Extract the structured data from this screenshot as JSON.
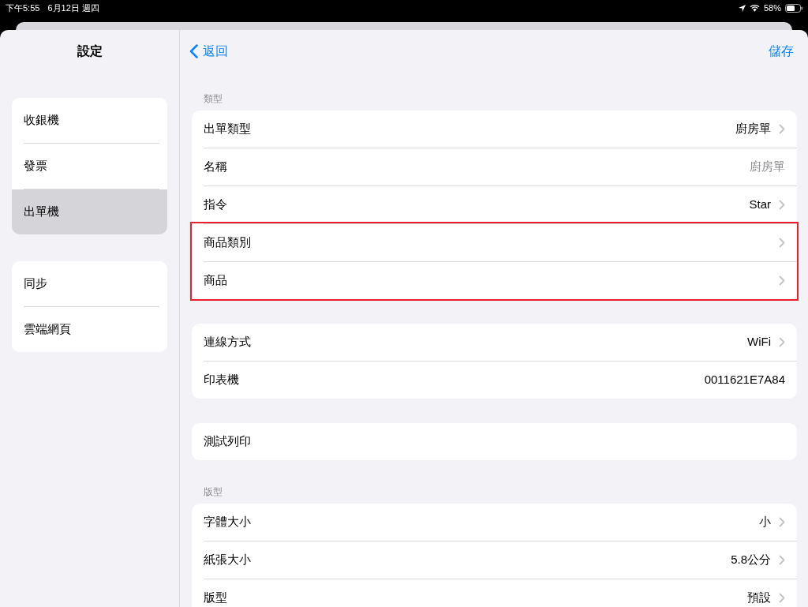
{
  "status_bar": {
    "time": "下午5:55",
    "date": "6月12日 週四",
    "battery": "58%"
  },
  "sidebar": {
    "title": "設定",
    "groups": [
      [
        {
          "label": "收銀機",
          "selected": false
        },
        {
          "label": "發票",
          "selected": false
        },
        {
          "label": "出單機",
          "selected": true
        }
      ],
      [
        {
          "label": "同步",
          "selected": false
        },
        {
          "label": "雲端網頁",
          "selected": false
        }
      ]
    ]
  },
  "nav": {
    "back": "返回",
    "save": "儲存"
  },
  "sections": [
    {
      "header": "類型",
      "rows": [
        {
          "kind": "nav",
          "label": "出單類型",
          "value": "廚房單",
          "highlighted": false
        },
        {
          "kind": "field",
          "label": "名稱",
          "placeholder": "廚房單",
          "highlighted": false
        },
        {
          "kind": "nav",
          "label": "指令",
          "value": "Star",
          "highlighted": false
        },
        {
          "kind": "nav",
          "label": "商品類別",
          "highlighted": true
        },
        {
          "kind": "nav",
          "label": "商品",
          "highlighted": true
        }
      ]
    },
    {
      "rows": [
        {
          "kind": "nav",
          "label": "連線方式",
          "value": "WiFi",
          "highlighted": false
        },
        {
          "kind": "info",
          "label": "印表機",
          "value": "0011621E7A84",
          "highlighted": false
        }
      ]
    },
    {
      "rows": [
        {
          "kind": "action",
          "label": "測試列印",
          "highlighted": false
        }
      ]
    },
    {
      "header": "版型",
      "rows": [
        {
          "kind": "nav",
          "label": "字體大小",
          "value": "小",
          "highlighted": false
        },
        {
          "kind": "nav",
          "label": "紙張大小",
          "value": "5.8公分",
          "highlighted": false
        },
        {
          "kind": "nav",
          "label": "版型",
          "value": "預設",
          "highlighted": false
        }
      ]
    }
  ]
}
